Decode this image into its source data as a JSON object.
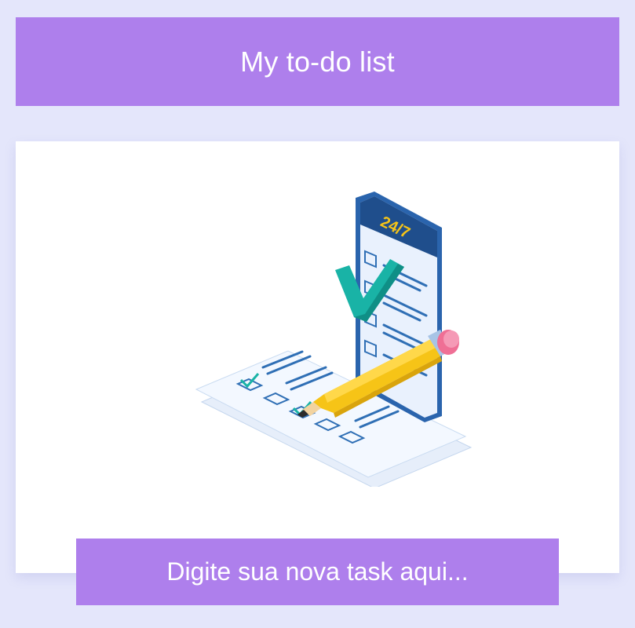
{
  "header": {
    "title": "My to-do list"
  },
  "illustration": {
    "badge_text": "24/7"
  },
  "task_input": {
    "placeholder": "Digite sua nova task aqui...",
    "value": ""
  },
  "colors": {
    "background": "#e4e6fb",
    "accent": "#ae7fec",
    "card": "#ffffff",
    "phone_blue": "#1f4e8c",
    "pencil_yellow": "#f6c417",
    "check_teal": "#19b3a6"
  }
}
